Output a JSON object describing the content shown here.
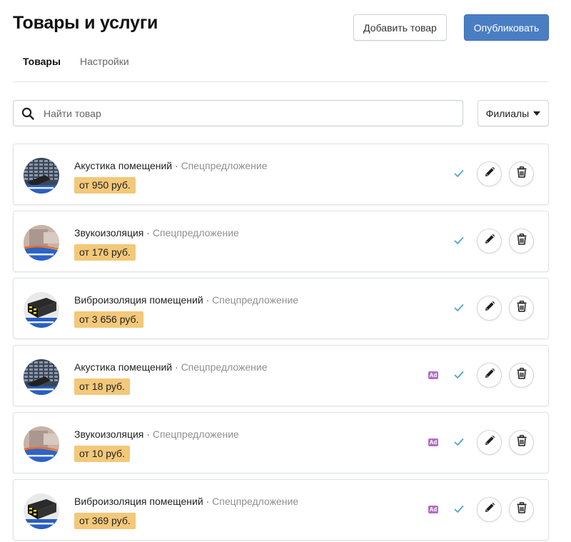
{
  "header": {
    "title": "Товары и услуги",
    "add_button": "Добавить товар",
    "publish_button": "Опубликовать"
  },
  "tabs": [
    {
      "label": "Товары",
      "active": true
    },
    {
      "label": "Настройки",
      "active": false
    }
  ],
  "search": {
    "placeholder": "Найти товар",
    "value": "",
    "icon": "search-icon"
  },
  "filter": {
    "label": "Филиалы",
    "icon": "caret-down-icon"
  },
  "colors": {
    "accent": "#4a7ec3",
    "price_badge": "#f3c879",
    "check": "#4fa6c6",
    "ad_badge": "#b06fc3"
  },
  "items": [
    {
      "name": "Акустика помещений",
      "separator": "·",
      "tag": "Спецпредложение",
      "price": "от 950 руб.",
      "ad": false,
      "ad_label": "",
      "published": true,
      "image": "acoustic-panel-image"
    },
    {
      "name": "Звукоизоляция",
      "separator": "·",
      "tag": "Спецпредложение",
      "price": "от 176 руб.",
      "ad": false,
      "ad_label": "",
      "published": true,
      "image": "soundproofing-image"
    },
    {
      "name": "Виброизоляция помещений",
      "separator": "·",
      "tag": "Спецпредложение",
      "price": "от 3 656 руб.",
      "ad": false,
      "ad_label": "",
      "published": true,
      "image": "vibration-isolation-image"
    },
    {
      "name": "Акустика помещений",
      "separator": "·",
      "tag": "Спецпредложение",
      "price": "от 18 руб.",
      "ad": true,
      "ad_label": "Ad",
      "published": true,
      "image": "acoustic-panel-image"
    },
    {
      "name": "Звукоизоляция",
      "separator": "·",
      "tag": "Спецпредложение",
      "price": "от 10 руб.",
      "ad": true,
      "ad_label": "Ad",
      "published": true,
      "image": "soundproofing-image"
    },
    {
      "name": "Виброизоляция помещений",
      "separator": "·",
      "tag": "Спецпредложение",
      "price": "от 369 руб.",
      "ad": true,
      "ad_label": "Ad",
      "published": true,
      "image": "vibration-isolation-image"
    }
  ],
  "actions": {
    "edit_icon": "pencil-icon",
    "delete_icon": "trash-icon",
    "published_icon": "check-icon"
  }
}
